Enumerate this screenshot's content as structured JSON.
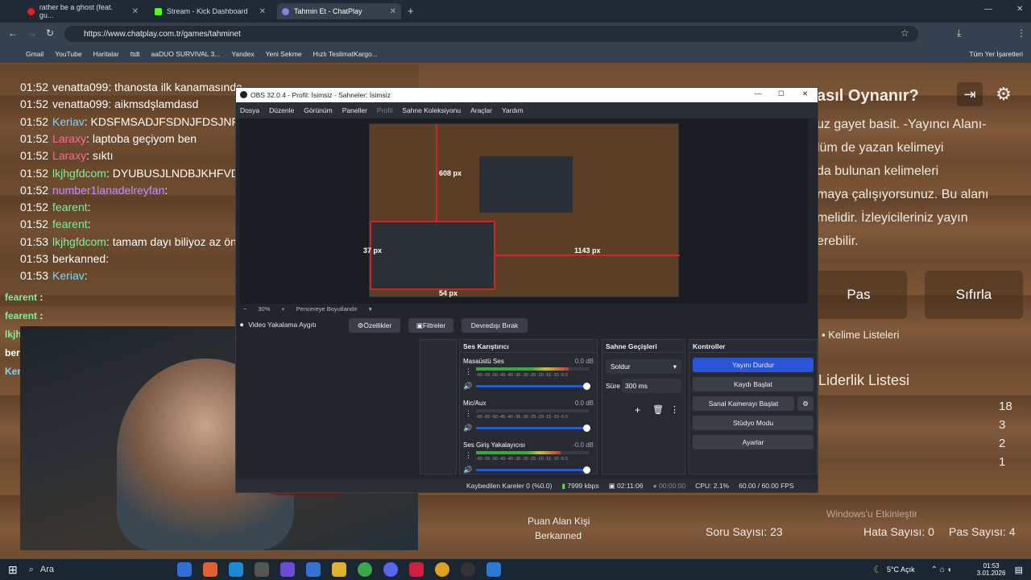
{
  "browser": {
    "tabs": [
      {
        "title": "rather be a ghost (feat. gu...",
        "icon_color": "#e02020"
      },
      {
        "title": "Stream - Kick Dashboard",
        "icon_color": "#53fc18"
      },
      {
        "title": "Tahmin Et - ChatPlay",
        "icon_color": "#8a7fe0"
      }
    ],
    "url": "https://www.chatplay.com.tr/games/tahminet",
    "bookmarks": [
      "Gmail",
      "YouTube",
      "Haritalar",
      "ttdt",
      "aaDUO SURVIVAL 3...",
      "Yandex",
      "Yeni Sekme",
      "Hızlı TeslimatKargo..."
    ],
    "all_bookmarks": "Tüm Yer İşaretleri"
  },
  "chat": [
    {
      "time": "01:52",
      "user": "venatta099",
      "color": "#ffffff",
      "msg": "thanosta ilk kanamasında"
    },
    {
      "time": "01:52",
      "user": "venatta099",
      "color": "#ffffff",
      "msg": "aikmsdşlamdasd"
    },
    {
      "time": "01:52",
      "user": "Keriav",
      "color": "#7fd6ff",
      "msg": "KDSFMSADJFSDNJFDSJNFDS"
    },
    {
      "time": "01:52",
      "user": "Laraxy",
      "color": "#ff6a8a",
      "msg": "laptoba geçiyom ben"
    },
    {
      "time": "01:52",
      "user": "Laraxy",
      "color": "#ff6a8a",
      "msg": "sıktı"
    },
    {
      "time": "01:52",
      "user": "lkjhgfdcom",
      "color": "#7ff29a",
      "msg": "DYUBUSJLNDBJKHFVDB("
    },
    {
      "time": "01:52",
      "user": "number1lanadelreyfan",
      "color": "#c48cff",
      "msg": ""
    },
    {
      "time": "01:52",
      "user": "fearent",
      "color": "#7ff29a",
      "msg": ""
    },
    {
      "time": "01:52",
      "user": "fearent",
      "color": "#7ff29a",
      "msg": ""
    },
    {
      "time": "01:53",
      "user": "lkjhgfdcom",
      "color": "#7ff29a",
      "msg": "tamam dayı biliyoz az ön"
    },
    {
      "time": "01:53",
      "user": "berkanned",
      "color": "#ffffff",
      "msg": ""
    },
    {
      "time": "01:53",
      "user": "Keriav",
      "color": "#7fd6ff",
      "msg": ""
    }
  ],
  "overlay_chat": [
    {
      "user": "fearent",
      "color": "#7ff29a",
      "msg": ""
    },
    {
      "user": "fearent",
      "color": "#7ff29a",
      "msg": ""
    },
    {
      "user": "lkjhgfdcom",
      "color": "#7ff29a",
      "msg": "tamam dayı biliyoz az öncede yazdın laptopu"
    },
    {
      "user": "berkanned",
      "color": "#ffffff",
      "msg": ""
    },
    {
      "user": "Keriav",
      "color": "#7fd6ff",
      "msg": ""
    }
  ],
  "game": {
    "heading": "asıl Oynanır?",
    "desc": [
      "uz gayet basit. -Yayıncı Alanı-",
      "lüm de yazan kelimeyi",
      "da bulunan kelimeleri",
      "maya çalışıyorsunuz. Bu alanı",
      "melidir. İzleyicileriniz yayın",
      "erebilir."
    ],
    "pass": "Pas",
    "reset": "Sıfırla",
    "word_lists": "Kelime Listeleri",
    "leaderboard": "Liderlik Listesi",
    "scores": [
      "18",
      "3",
      "2",
      "1"
    ],
    "scorer_label": "Puan Alan Kişi",
    "scorer": "Berkanned",
    "question_count": "Soru Sayısı: 23",
    "error_count": "Hata Sayısı: 0",
    "pass_count": "Pas Sayısı: 4",
    "windows_activate": "Windows'u Etkinleştir"
  },
  "obs": {
    "title": "OBS 32.0.4 - Profil: İsimsiz - Sahneler: İsimsiz",
    "menu": [
      "Dosya",
      "Düzenle",
      "Görünüm",
      "Paneller",
      "Profil",
      "Sahne Koleksiyonu",
      "Araçlar",
      "Yardım"
    ],
    "dims": {
      "top": "608 px",
      "left": "37 px",
      "right": "1143 px",
      "bottom": "54 px"
    },
    "zoom": "30%",
    "fit": "Pencereye Boyutlandır",
    "source": "Video Yakalama Aygıtı",
    "props": "Özellikler",
    "filters": "Filtreler",
    "deactivate": "Devredışı Bırak",
    "mixer_title": "Ses Karıştırıcı",
    "mixer": [
      {
        "name": "Masaüstü Ses",
        "db": "0.0 dB",
        "level": 0.82
      },
      {
        "name": "Mic/Aux",
        "db": "0.0 dB",
        "level": 0.0
      },
      {
        "name": "Ses Giriş Yakalayıcısı",
        "db": "-0.0 dB",
        "level": 0.75
      }
    ],
    "meter_ticks": "-60 -55 -50 -45 -40 -35 -30 -25 -20 -15 -10 -5 0",
    "trans_title": "Sahne Geçişleri",
    "transition": "Soldur",
    "duration_label": "Süre",
    "duration": "300 ms",
    "controls_title": "Kontroller",
    "controls": [
      "Yayını Durdur",
      "Kaydı Başlat",
      "Sanal Kamerayı Başlat",
      "Stüdyo Modu",
      "Ayarlar"
    ],
    "status": {
      "dropped": "Kaybedilen Kareler 0 (%0.0)",
      "kbps": "7999 kbps",
      "stream_time": "02:11:06",
      "rec_time": "00:00:00",
      "cpu": "CPU: 2.1%",
      "fps": "60.00 / 60.00 FPS"
    }
  },
  "taskbar": {
    "search": "Ara",
    "weather": "5°C  Açık",
    "time": "01:53",
    "date": "3.01.2026"
  }
}
